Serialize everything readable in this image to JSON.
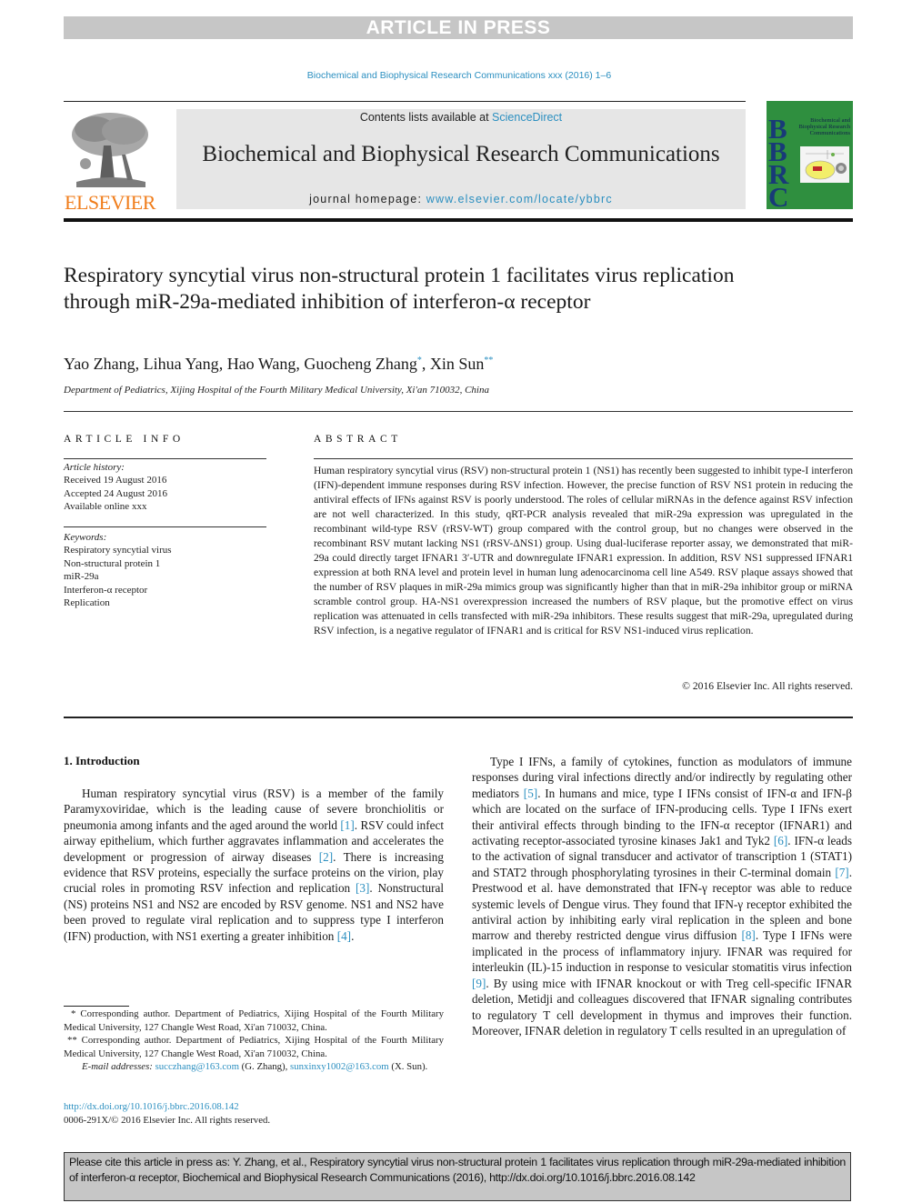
{
  "banner": {
    "text": "ARTICLE IN PRESS"
  },
  "journal_ref": "Biochemical and Biophysical Research Communications xxx (2016) 1–6",
  "header": {
    "publisher_logo_text": "ELSEVIER",
    "contents_prefix": "Contents lists available at ",
    "contents_link": "ScienceDirect",
    "journal_name": "Biochemical and Biophysical Research Communications",
    "homepage_prefix": "journal homepage: ",
    "homepage_link": "www.elsevier.com/locate/ybbrc",
    "cover": {
      "letters": [
        "B",
        "B",
        "R",
        "C"
      ],
      "title": "Biochemical and Biophysical Research Communications"
    }
  },
  "article": {
    "title": "Respiratory syncytial virus non-structural protein 1 facilitates virus replication through miR-29a-mediated inhibition of interferon-α receptor",
    "authors": [
      {
        "name": "Yao Zhang",
        "mark": ""
      },
      {
        "name": "Lihua Yang",
        "mark": ""
      },
      {
        "name": "Hao Wang",
        "mark": ""
      },
      {
        "name": "Guocheng Zhang",
        "mark": "*"
      },
      {
        "name": "Xin Sun",
        "mark": "**"
      }
    ],
    "affiliation": "Department of Pediatrics, Xijing Hospital of the Fourth Military Medical University, Xi'an 710032, China"
  },
  "article_info": {
    "heading": "ARTICLE INFO",
    "history_label": "Article history:",
    "history": [
      "Received 19 August 2016",
      "Accepted 24 August 2016",
      "Available online xxx"
    ],
    "keywords_label": "Keywords:",
    "keywords": [
      "Respiratory syncytial virus",
      "Non-structural protein 1",
      "miR-29a",
      "Interferon-α receptor",
      "Replication"
    ]
  },
  "abstract": {
    "heading": "ABSTRACT",
    "text": "Human respiratory syncytial virus (RSV) non-structural protein 1 (NS1) has recently been suggested to inhibit type-I interferon (IFN)-dependent immune responses during RSV infection. However, the precise function of RSV NS1 protein in reducing the antiviral effects of IFNs against RSV is poorly understood. The roles of cellular miRNAs in the defence against RSV infection are not well characterized. In this study, qRT-PCR analysis revealed that miR-29a expression was upregulated in the recombinant wild-type RSV (rRSV-WT) group compared with the control group, but no changes were observed in the recombinant RSV mutant lacking NS1 (rRSV-ΔNS1) group. Using dual-luciferase reporter assay, we demonstrated that miR-29a could directly target IFNAR1 3′-UTR and downregulate IFNAR1 expression. In addition, RSV NS1 suppressed IFNAR1 expression at both RNA level and protein level in human lung adenocarcinoma cell line A549. RSV plaque assays showed that the number of RSV plaques in miR-29a mimics group was significantly higher than that in miR-29a inhibitor group or miRNA scramble control group. HA-NS1 overexpression increased the numbers of RSV plaque, but the promotive effect on virus replication was attenuated in cells transfected with miR-29a inhibitors. These results suggest that miR-29a, upregulated during RSV infection, is a negative regulator of IFNAR1 and is critical for RSV NS1-induced virus replication.",
    "copyright": "© 2016 Elsevier Inc. All rights reserved."
  },
  "introduction": {
    "heading": "1.  Introduction",
    "p1": [
      {
        "t": "Human respiratory syncytial virus (RSV) is a member of the family Paramyxoviridae, which is the leading cause of severe bronchiolitis or pneumonia among infants and the aged around the world "
      },
      {
        "ref": "[1]"
      },
      {
        "t": ". RSV could infect airway epithelium, which further aggravates inflammation and accelerates the development or progression of airway diseases "
      },
      {
        "ref": "[2]"
      },
      {
        "t": ". There is increasing evidence that RSV proteins, especially the surface proteins on the virion, play crucial roles in promoting RSV infection and replication "
      },
      {
        "ref": "[3]"
      },
      {
        "t": ". Nonstructural (NS) proteins NS1 and NS2 are encoded by RSV genome. NS1 and NS2 have been proved to regulate viral replication and to suppress type I interferon (IFN) production, with NS1 exerting a greater inhibition "
      },
      {
        "ref": "[4]"
      },
      {
        "t": "."
      }
    ],
    "p2": [
      {
        "t": "Type I IFNs, a family of cytokines, function as modulators of immune responses during viral infections directly and/or indirectly by regulating other mediators "
      },
      {
        "ref": "[5]"
      },
      {
        "t": ". In humans and mice, type I IFNs consist of IFN-α and IFN-β which are located on the surface of IFN-producing cells. Type I IFNs exert their antiviral effects through binding to the IFN-α receptor (IFNAR1) and activating receptor-associated tyrosine kinases Jak1 and Tyk2 "
      },
      {
        "ref": "[6]"
      },
      {
        "t": ". IFN-α leads to the activation of signal transducer and activator of transcription 1 (STAT1) and STAT2 through phosphorylating tyrosines in their C-terminal domain "
      },
      {
        "ref": "[7]"
      },
      {
        "t": ". Prestwood et al. have demonstrated that IFN-γ receptor was able to reduce systemic levels of Dengue virus. They found that IFN-γ receptor exhibited the antiviral action by inhibiting early viral replication in the spleen and bone marrow and thereby restricted dengue virus diffusion "
      },
      {
        "ref": "[8]"
      },
      {
        "t": ". Type I IFNs were implicated in the process of inflammatory injury. IFNAR was required for interleukin (IL)-15 induction in response to vesicular stomatitis virus infection "
      },
      {
        "ref": "[9]"
      },
      {
        "t": ". By using mice with IFNAR knockout or with Treg cell-specific IFNAR deletion, Metidji and colleagues discovered that IFNAR signaling contributes to regulatory T cell development in thymus and improves their function. Moreover, IFNAR deletion in regulatory T cells resulted in an upregulation of"
      }
    ]
  },
  "footnotes": {
    "fn1": "* Corresponding author. Department of Pediatrics, Xijing Hospital of the Fourth Military Medical University, 127 Changle West Road, Xi'an 710032, China.",
    "fn2": "** Corresponding author. Department of Pediatrics, Xijing Hospital of the Fourth Military Medical University, 127 Changle West Road, Xi'an 710032, China.",
    "email_label": "E-mail addresses:",
    "email1": "succzhang@163.com",
    "email1_owner": " (G. Zhang), ",
    "email2": "sunxinxy1002@163.com",
    "email2_owner": " (X. Sun).",
    "doi": "http://dx.doi.org/10.1016/j.bbrc.2016.08.142",
    "issn": "0006-291X/© 2016 Elsevier Inc. All rights reserved."
  },
  "citation_box": {
    "text": "Please cite this article in press as: Y. Zhang, et al., Respiratory syncytial virus non-structural protein 1 facilitates virus replication through miR-29a-mediated inhibition of interferon-α receptor, Biochemical and Biophysical Research Communications (2016), http://dx.doi.org/10.1016/j.bbrc.2016.08.142"
  },
  "colors": {
    "link": "#2b8fc0",
    "elsevier_orange": "#f07d1b",
    "banner_gray": "#c6c6c6",
    "header_box_gray": "#e6e6e6",
    "cover_green": "#2f8f3f",
    "cover_letters": "#183a78"
  }
}
